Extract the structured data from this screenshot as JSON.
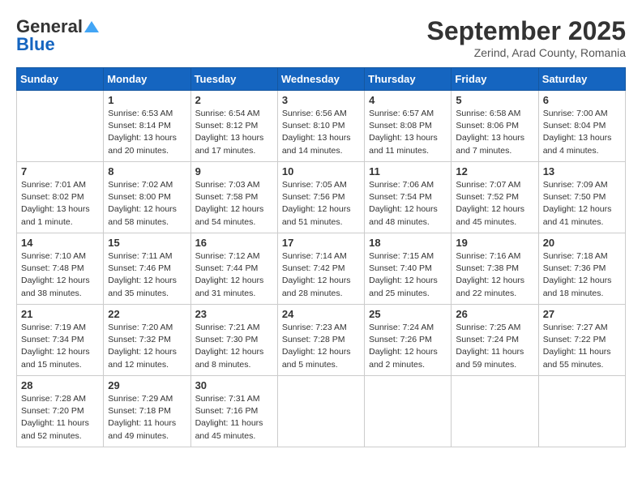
{
  "header": {
    "logo_general": "General",
    "logo_blue": "Blue",
    "month_title": "September 2025",
    "location": "Zerind, Arad County, Romania"
  },
  "days_of_week": [
    "Sunday",
    "Monday",
    "Tuesday",
    "Wednesday",
    "Thursday",
    "Friday",
    "Saturday"
  ],
  "weeks": [
    [
      {
        "day": "",
        "info": ""
      },
      {
        "day": "1",
        "info": "Sunrise: 6:53 AM\nSunset: 8:14 PM\nDaylight: 13 hours\nand 20 minutes."
      },
      {
        "day": "2",
        "info": "Sunrise: 6:54 AM\nSunset: 8:12 PM\nDaylight: 13 hours\nand 17 minutes."
      },
      {
        "day": "3",
        "info": "Sunrise: 6:56 AM\nSunset: 8:10 PM\nDaylight: 13 hours\nand 14 minutes."
      },
      {
        "day": "4",
        "info": "Sunrise: 6:57 AM\nSunset: 8:08 PM\nDaylight: 13 hours\nand 11 minutes."
      },
      {
        "day": "5",
        "info": "Sunrise: 6:58 AM\nSunset: 8:06 PM\nDaylight: 13 hours\nand 7 minutes."
      },
      {
        "day": "6",
        "info": "Sunrise: 7:00 AM\nSunset: 8:04 PM\nDaylight: 13 hours\nand 4 minutes."
      }
    ],
    [
      {
        "day": "7",
        "info": "Sunrise: 7:01 AM\nSunset: 8:02 PM\nDaylight: 13 hours\nand 1 minute."
      },
      {
        "day": "8",
        "info": "Sunrise: 7:02 AM\nSunset: 8:00 PM\nDaylight: 12 hours\nand 58 minutes."
      },
      {
        "day": "9",
        "info": "Sunrise: 7:03 AM\nSunset: 7:58 PM\nDaylight: 12 hours\nand 54 minutes."
      },
      {
        "day": "10",
        "info": "Sunrise: 7:05 AM\nSunset: 7:56 PM\nDaylight: 12 hours\nand 51 minutes."
      },
      {
        "day": "11",
        "info": "Sunrise: 7:06 AM\nSunset: 7:54 PM\nDaylight: 12 hours\nand 48 minutes."
      },
      {
        "day": "12",
        "info": "Sunrise: 7:07 AM\nSunset: 7:52 PM\nDaylight: 12 hours\nand 45 minutes."
      },
      {
        "day": "13",
        "info": "Sunrise: 7:09 AM\nSunset: 7:50 PM\nDaylight: 12 hours\nand 41 minutes."
      }
    ],
    [
      {
        "day": "14",
        "info": "Sunrise: 7:10 AM\nSunset: 7:48 PM\nDaylight: 12 hours\nand 38 minutes."
      },
      {
        "day": "15",
        "info": "Sunrise: 7:11 AM\nSunset: 7:46 PM\nDaylight: 12 hours\nand 35 minutes."
      },
      {
        "day": "16",
        "info": "Sunrise: 7:12 AM\nSunset: 7:44 PM\nDaylight: 12 hours\nand 31 minutes."
      },
      {
        "day": "17",
        "info": "Sunrise: 7:14 AM\nSunset: 7:42 PM\nDaylight: 12 hours\nand 28 minutes."
      },
      {
        "day": "18",
        "info": "Sunrise: 7:15 AM\nSunset: 7:40 PM\nDaylight: 12 hours\nand 25 minutes."
      },
      {
        "day": "19",
        "info": "Sunrise: 7:16 AM\nSunset: 7:38 PM\nDaylight: 12 hours\nand 22 minutes."
      },
      {
        "day": "20",
        "info": "Sunrise: 7:18 AM\nSunset: 7:36 PM\nDaylight: 12 hours\nand 18 minutes."
      }
    ],
    [
      {
        "day": "21",
        "info": "Sunrise: 7:19 AM\nSunset: 7:34 PM\nDaylight: 12 hours\nand 15 minutes."
      },
      {
        "day": "22",
        "info": "Sunrise: 7:20 AM\nSunset: 7:32 PM\nDaylight: 12 hours\nand 12 minutes."
      },
      {
        "day": "23",
        "info": "Sunrise: 7:21 AM\nSunset: 7:30 PM\nDaylight: 12 hours\nand 8 minutes."
      },
      {
        "day": "24",
        "info": "Sunrise: 7:23 AM\nSunset: 7:28 PM\nDaylight: 12 hours\nand 5 minutes."
      },
      {
        "day": "25",
        "info": "Sunrise: 7:24 AM\nSunset: 7:26 PM\nDaylight: 12 hours\nand 2 minutes."
      },
      {
        "day": "26",
        "info": "Sunrise: 7:25 AM\nSunset: 7:24 PM\nDaylight: 11 hours\nand 59 minutes."
      },
      {
        "day": "27",
        "info": "Sunrise: 7:27 AM\nSunset: 7:22 PM\nDaylight: 11 hours\nand 55 minutes."
      }
    ],
    [
      {
        "day": "28",
        "info": "Sunrise: 7:28 AM\nSunset: 7:20 PM\nDaylight: 11 hours\nand 52 minutes."
      },
      {
        "day": "29",
        "info": "Sunrise: 7:29 AM\nSunset: 7:18 PM\nDaylight: 11 hours\nand 49 minutes."
      },
      {
        "day": "30",
        "info": "Sunrise: 7:31 AM\nSunset: 7:16 PM\nDaylight: 11 hours\nand 45 minutes."
      },
      {
        "day": "",
        "info": ""
      },
      {
        "day": "",
        "info": ""
      },
      {
        "day": "",
        "info": ""
      },
      {
        "day": "",
        "info": ""
      }
    ]
  ]
}
